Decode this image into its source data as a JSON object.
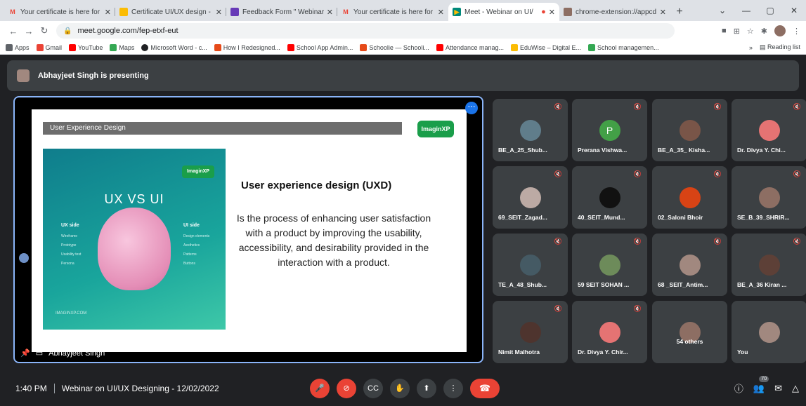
{
  "tabs": [
    {
      "title": "Your certificate is here for",
      "fav_color": "#ea4335",
      "fav_glyph": "M"
    },
    {
      "title": "Certificate UI/UX design -",
      "fav_color": "#fbbc04",
      "fav_glyph": "▭"
    },
    {
      "title": "Feedback Form \" Webinar",
      "fav_color": "#673ab7",
      "fav_glyph": "▤"
    },
    {
      "title": "Your certificate is here for",
      "fav_color": "#ea4335",
      "fav_glyph": "M"
    },
    {
      "title": "Meet - Webinar on UI/",
      "fav_color": "#00897b",
      "fav_glyph": "▶",
      "active": true
    },
    {
      "title": "chrome-extension://appcd",
      "fav_color": "#8d6e63",
      "fav_glyph": "▦"
    }
  ],
  "address": {
    "url": "meet.google.com/fep-etxf-eut"
  },
  "bookmarks": [
    {
      "label": "Apps",
      "color": "#5f6368"
    },
    {
      "label": "Gmail",
      "color": "#ea4335"
    },
    {
      "label": "YouTube",
      "color": "#ff0000"
    },
    {
      "label": "Maps",
      "color": "#34a853"
    },
    {
      "label": "Microsoft Word - c...",
      "color": "#202124"
    },
    {
      "label": "How I Redesigned...",
      "color": "#e64a19"
    },
    {
      "label": "School App Admin...",
      "color": "#ff0000"
    },
    {
      "label": "Schoolie — Schooli...",
      "color": "#e64a19"
    },
    {
      "label": "Attendance manag...",
      "color": "#ff0000"
    },
    {
      "label": "EduWise – Digital E...",
      "color": "#fbbc04"
    },
    {
      "label": "School managemen...",
      "color": "#34a853"
    }
  ],
  "bookmarks_more": "»",
  "reading_list": "Reading list",
  "presenter_banner": "Abhayjeet Singh is presenting",
  "slide": {
    "header": "User Experience Design",
    "logo": "ImaginXP",
    "image_logo": "ImaginXP",
    "image_title": "UX VS UI",
    "ux_side": "UX side",
    "ui_side": "UI side",
    "ux_items": [
      "Wireframe",
      "Prototype",
      "Usability test",
      "Persona"
    ],
    "ui_items": [
      "Design elements",
      "Aesthetics",
      "Patterns",
      "Buttons"
    ],
    "image_footer": "IMAGINXP.COM",
    "heading": "User experience design (UXD)",
    "body": "Is the process of enhancing user satisfaction with a product by improving the usability, accessibility, and desirability provided in the interaction with a product."
  },
  "stage_owner": "Abhayjeet Singh",
  "participants": [
    {
      "name": "BE_A_25_Shub...",
      "color": "#607d8b"
    },
    {
      "name": "Prerana Vishwa...",
      "color": "#43a047",
      "initial": "P"
    },
    {
      "name": "BE_A_35_ Kisha...",
      "color": "#795548"
    },
    {
      "name": "Dr. Divya Y. Chi...",
      "color": "#e57373"
    },
    {
      "name": "69_SEIT_Zagad...",
      "color": "#bcaaa4"
    },
    {
      "name": "40_SEIT_Mund...",
      "color": "#111111"
    },
    {
      "name": "02_Saloni Bhoir",
      "color": "#d84315"
    },
    {
      "name": "SE_B_39_SHRIR...",
      "color": "#8d6e63"
    },
    {
      "name": "TE_A_48_Shub...",
      "color": "#455a64"
    },
    {
      "name": "59 SEIT SOHAN ...",
      "color": "#6d8b5a"
    },
    {
      "name": "68 _SEIT_Antim...",
      "color": "#a1887f"
    },
    {
      "name": "BE_A_36 Kiran ...",
      "color": "#5d4037"
    },
    {
      "name": "Nimit Malhotra",
      "color": "#4e342e"
    },
    {
      "name": "Dr. Divya Y. Chir...",
      "color": "#e57373"
    },
    {
      "name": "54 others",
      "color": "#8d6e63"
    },
    {
      "name": "You",
      "color": "#a1887f"
    }
  ],
  "bottom": {
    "time": "1:40 PM",
    "meeting_title": "Webinar on UI/UX Designing - 12/02/2022",
    "people_count": "70"
  }
}
